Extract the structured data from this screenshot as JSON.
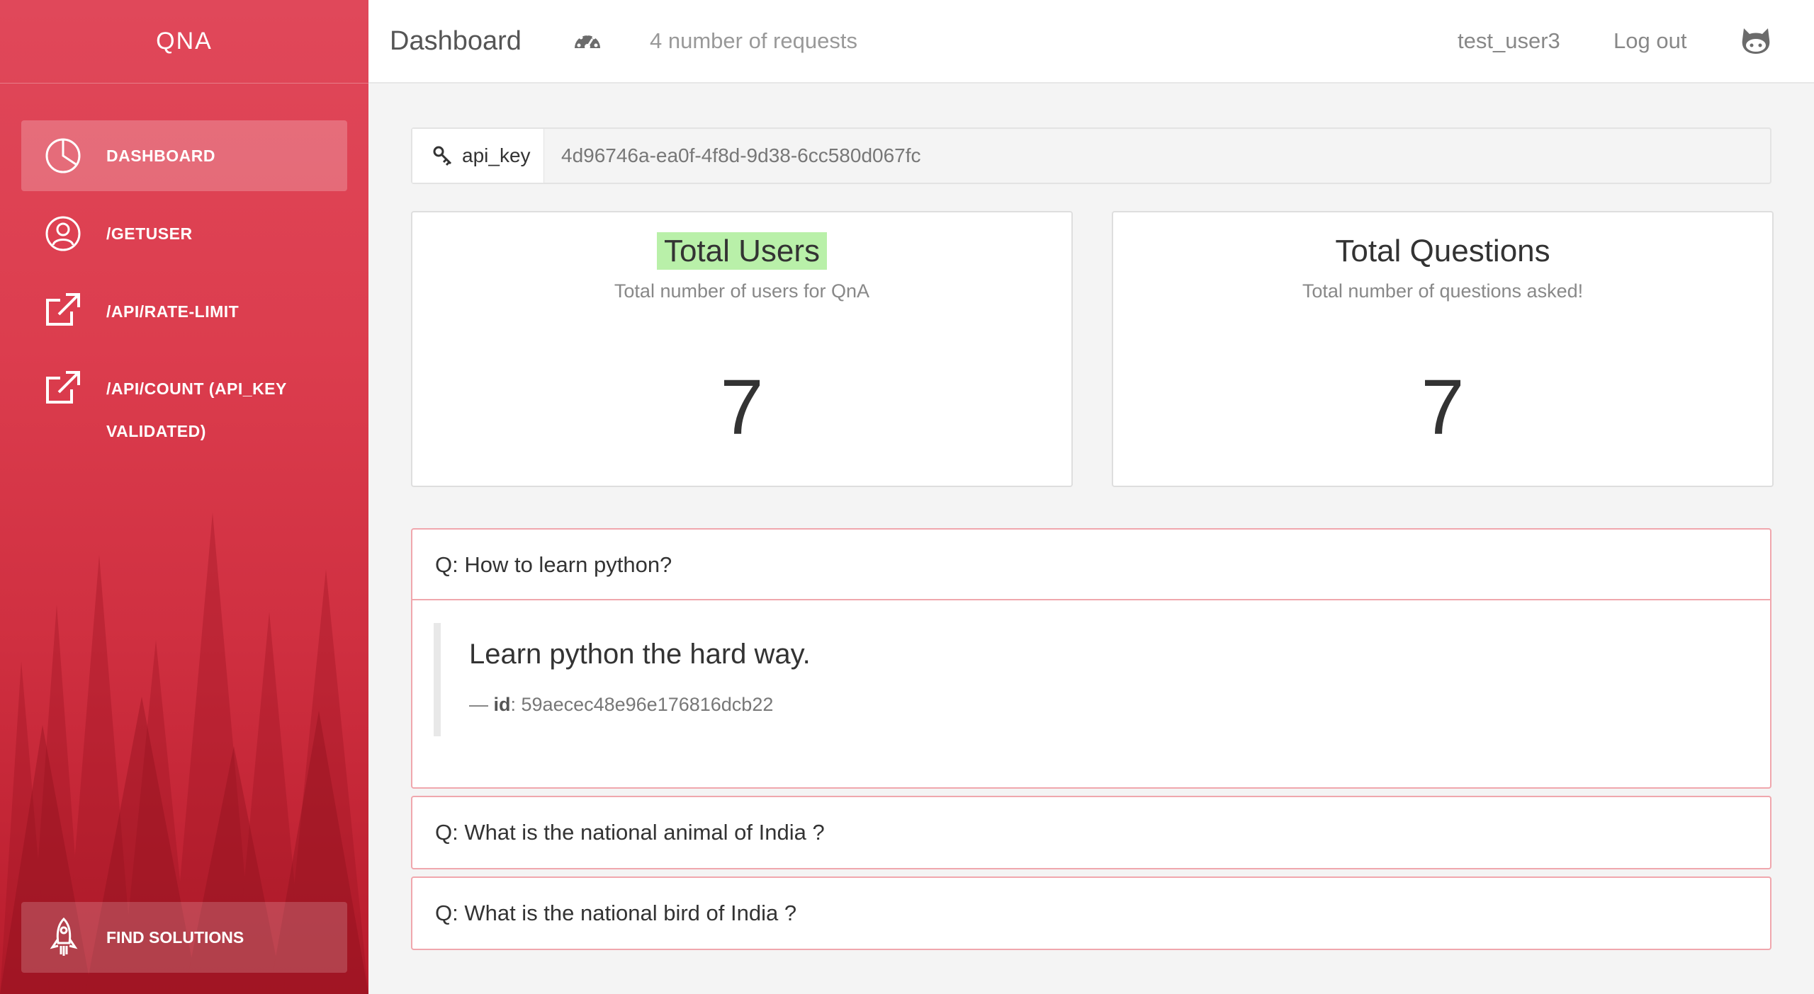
{
  "sidebar": {
    "brand": "QNA",
    "items": [
      {
        "label": "DASHBOARD",
        "icon": "pie-chart-icon",
        "active": true
      },
      {
        "label": "/GETUSER",
        "icon": "user-icon"
      },
      {
        "label": "/API/RATE-LIMIT",
        "icon": "external-link-icon"
      },
      {
        "label_line1": "/API/COUNT (API_KEY",
        "label_line2": "VALIDATED)",
        "icon": "external-link-icon"
      }
    ],
    "find_button": {
      "label": "FIND SOLUTIONS",
      "icon": "rocket-icon"
    }
  },
  "header": {
    "title": "Dashboard",
    "gauge_icon": "dashboard-gauge-icon",
    "requests": "4 number of requests",
    "username": "test_user3",
    "logout": "Log out",
    "github_icon": "github-icon"
  },
  "api_key": {
    "label": "api_key",
    "icon": "key-icon",
    "value": "4d96746a-ea0f-4f8d-9d38-6cc580d067fc"
  },
  "stats": [
    {
      "title": "Total Users",
      "subtitle": "Total number of users for QnA",
      "value": "7",
      "highlighted": true
    },
    {
      "title": "Total Questions",
      "subtitle": "Total number of questions asked!",
      "value": "7"
    }
  ],
  "questions": [
    {
      "question": "Q: How to learn python?",
      "expanded": true,
      "answer": "Learn python the hard way.",
      "answer_meta_prefix": "— ",
      "answer_meta_key": "id",
      "answer_meta_value": ": 59aecec48e96e176816dcb22"
    },
    {
      "question": "Q: What is the national animal of India ?",
      "expanded": false
    },
    {
      "question": "Q: What is the national bird of India ?",
      "expanded": false
    }
  ],
  "colors": {
    "sidebar_red": "#dc3d4e",
    "highlight_green": "#b9f0a9",
    "panel_border": "#f0a7ad"
  }
}
